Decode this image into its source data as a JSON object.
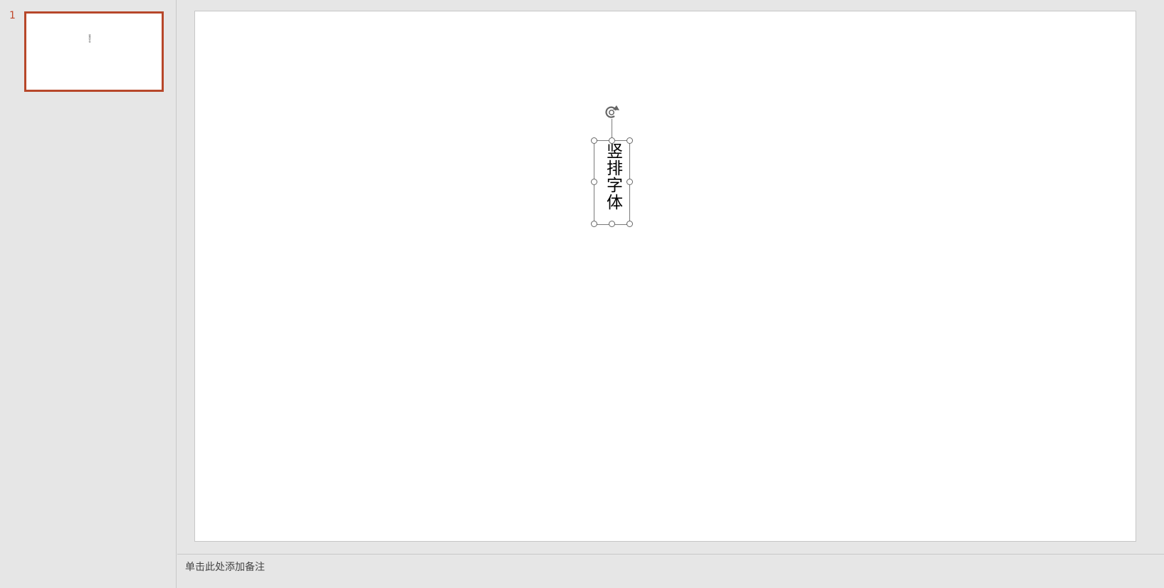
{
  "thumbnails": [
    {
      "number": "1",
      "preview_text": "竖排字体",
      "selected": true
    }
  ],
  "slide": {
    "textbox": {
      "text": "竖排字体",
      "orientation": "vertical"
    }
  },
  "notes": {
    "placeholder": "单击此处添加备注"
  },
  "colors": {
    "accent": "#b7472a",
    "background": "#e6e6e6",
    "slide_background": "#ffffff",
    "handle_stroke": "#666666"
  },
  "icons": {
    "rotate": "rotate-icon"
  }
}
